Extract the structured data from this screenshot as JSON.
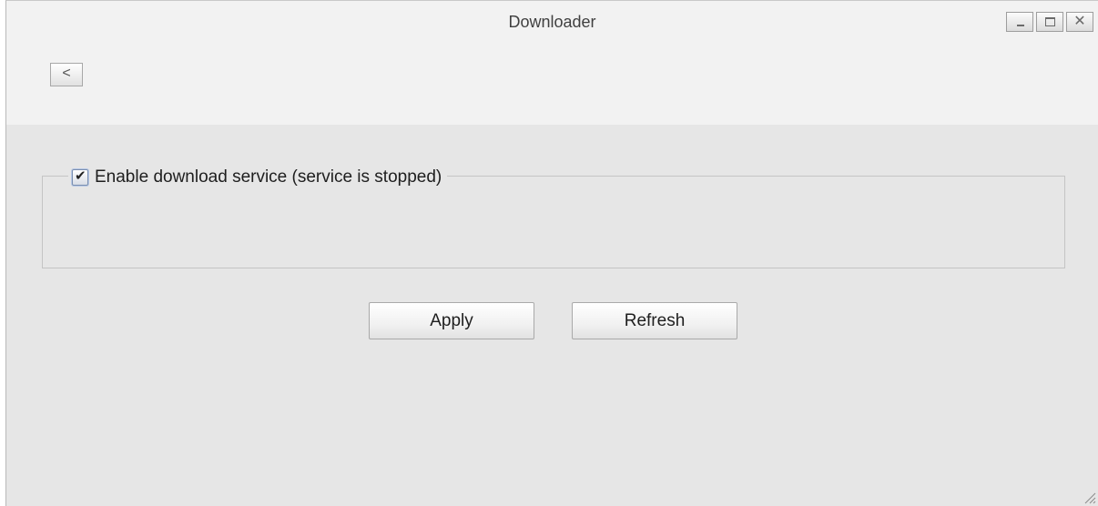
{
  "window": {
    "title": "Downloader",
    "controls": {
      "minimize_icon": "minimize-icon",
      "maximize_icon": "maximize-icon",
      "close_glyph": "✕"
    }
  },
  "nav": {
    "back_label": "<"
  },
  "service": {
    "enabled": true,
    "checkbox_label": "Enable download service (service is stopped)"
  },
  "actions": {
    "apply_label": "Apply",
    "refresh_label": "Refresh"
  },
  "colors": {
    "titlebar": "#f2f2f2",
    "panel": "#e6e6e6",
    "border": "#c4c4c4"
  }
}
